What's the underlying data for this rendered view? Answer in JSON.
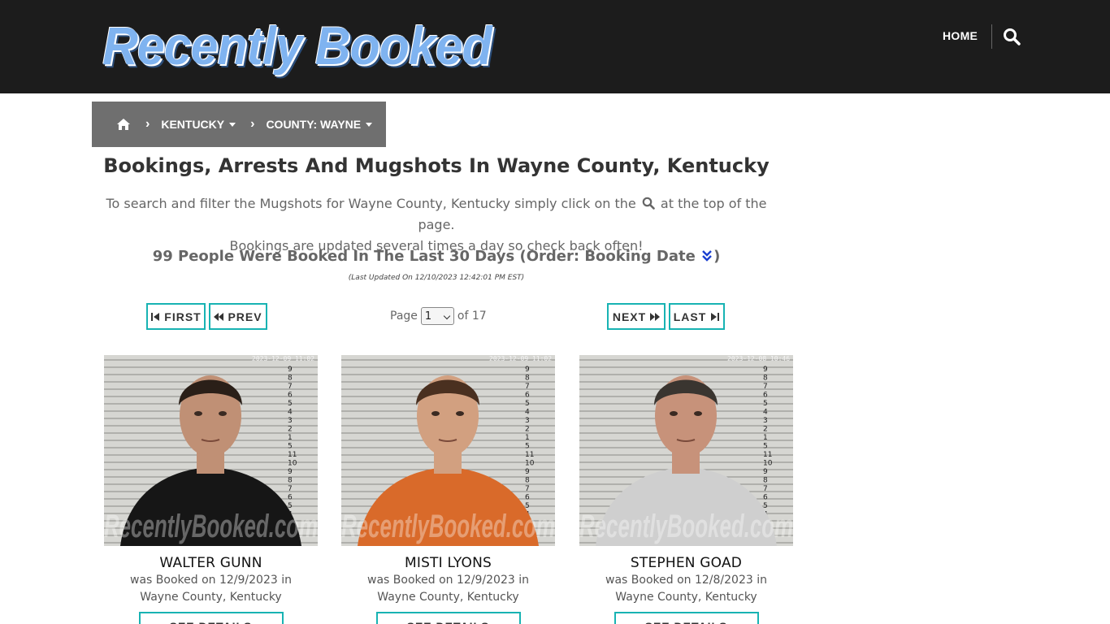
{
  "header": {
    "logo_text": "Recently Booked",
    "nav": {
      "home_label": "HOME",
      "search_icon": "search-icon"
    }
  },
  "breadcrumb": {
    "home_icon": "home-icon",
    "items": [
      {
        "label": "KENTUCKY"
      },
      {
        "label": "COUNTY: WAYNE"
      }
    ]
  },
  "main": {
    "title": "Bookings, Arrests And Mugshots In Wayne County, Kentucky",
    "intro_before": "To search and filter the Mugshots for Wayne County, Kentucky simply click on the",
    "intro_after": "at the top of the page.",
    "intro_line2": "Bookings are updated several times a day so check back often!",
    "count_text": "99 People Were Booked In The Last 30 Days (Order: Booking Date",
    "count_close": ")",
    "last_updated": "(Last Updated On 12/10/2023 12:42:01 PM EST)"
  },
  "pager": {
    "first_label": "FIRST",
    "prev_label": "PREV",
    "next_label": "NEXT",
    "last_label": "LAST",
    "page_word": "Page",
    "current_page": "1",
    "of_text": "of 17"
  },
  "watermark": "RecentlyBooked.com",
  "bookings": [
    {
      "name": "WALTER GUNN",
      "line1": "was Booked on 12/9/2023 in",
      "line2": "Wayne County, Kentucky",
      "button": "SEE DETAILS",
      "shirt": "#161616",
      "skin": "#c09075",
      "hair": "#2a1f18",
      "stamp": "2023-12-09 11:02"
    },
    {
      "name": "MISTI LYONS",
      "line1": "was Booked on 12/9/2023 in",
      "line2": "Wayne County, Kentucky",
      "button": "SEE DETAILS",
      "shirt": "#d96a2a",
      "skin": "#d2a080",
      "hair": "#4a3020",
      "stamp": "2023-12-09 11:02"
    },
    {
      "name": "STEPHEN GOAD",
      "line1": "was Booked on 12/8/2023 in",
      "line2": "Wayne County, Kentucky",
      "button": "SEE DETAILS",
      "shirt": "#cfcfcf",
      "skin": "#c7927a",
      "hair": "#3a3530",
      "stamp": "2023-12-08 10:46"
    }
  ]
}
